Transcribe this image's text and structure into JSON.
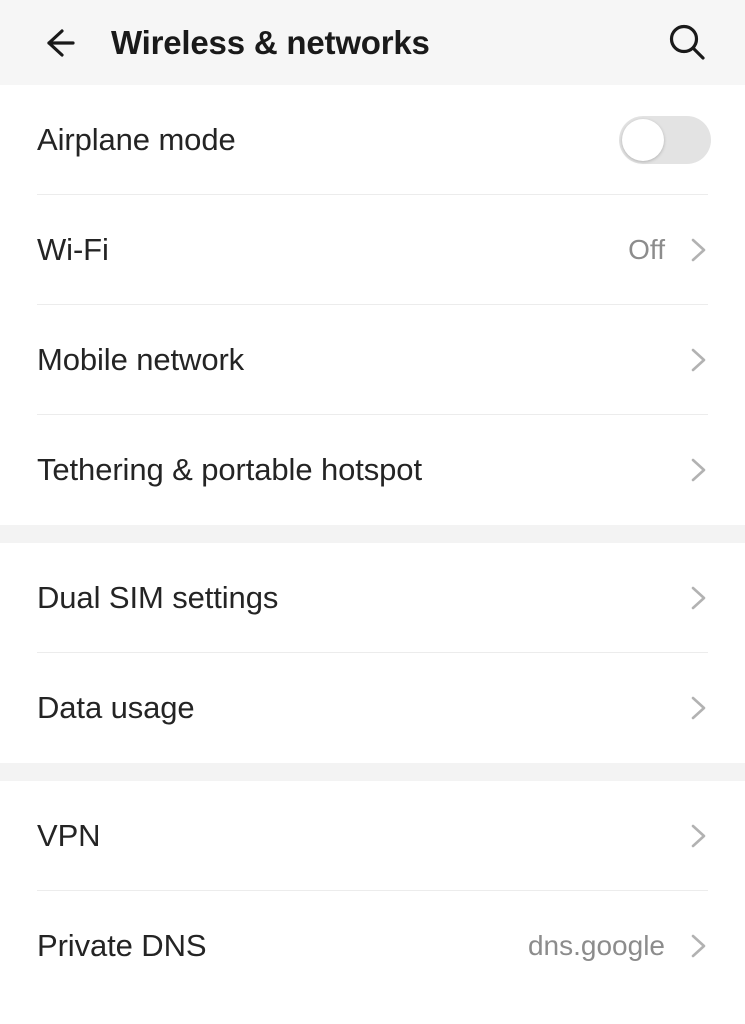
{
  "header": {
    "title": "Wireless & networks",
    "back_icon": "arrow-left-icon",
    "search_icon": "search-icon"
  },
  "theme": {
    "appbar_bg": "#f6f6f6",
    "content_bg": "#ffffff",
    "separator_bg": "#f3f3f3",
    "divider": "#ececec",
    "label_color": "#242424",
    "value_color": "#8c8c8c",
    "toggle_off_track": "#e3e3e3"
  },
  "groups": [
    {
      "rows": [
        {
          "label": "Airplane mode",
          "control": "toggle",
          "toggle_state": "off",
          "value": ""
        },
        {
          "label": "Wi-Fi",
          "control": "chevron",
          "value": "Off"
        },
        {
          "label": "Mobile network",
          "control": "chevron",
          "value": ""
        },
        {
          "label": "Tethering & portable hotspot",
          "control": "chevron",
          "value": ""
        }
      ]
    },
    {
      "rows": [
        {
          "label": "Dual SIM settings",
          "control": "chevron",
          "value": ""
        },
        {
          "label": "Data usage",
          "control": "chevron",
          "value": ""
        }
      ]
    },
    {
      "rows": [
        {
          "label": "VPN",
          "control": "chevron",
          "value": ""
        },
        {
          "label": "Private DNS",
          "control": "chevron",
          "value": "dns.google"
        }
      ]
    }
  ]
}
